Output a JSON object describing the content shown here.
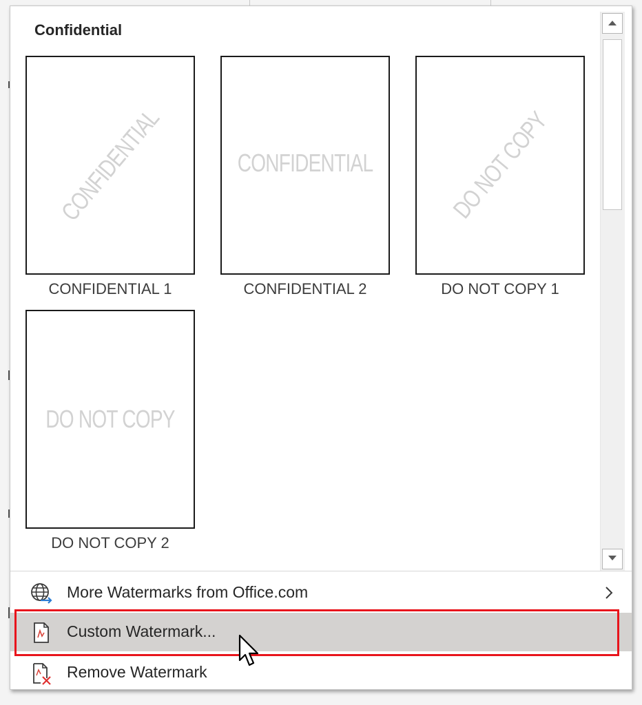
{
  "gallery": {
    "section_title": "Confidential",
    "items": [
      {
        "label": "CONFIDENTIAL 1",
        "watermark_text": "CONFIDENTIAL",
        "orientation": "diagonal"
      },
      {
        "label": "CONFIDENTIAL 2",
        "watermark_text": "CONFIDENTIAL",
        "orientation": "horizontal"
      },
      {
        "label": "DO NOT COPY 1",
        "watermark_text": "DO NOT COPY",
        "orientation": "diagonal"
      },
      {
        "label": "DO NOT COPY 2",
        "watermark_text": "DO NOT COPY",
        "orientation": "horizontal"
      }
    ]
  },
  "menu": {
    "more_watermarks": {
      "label": "More Watermarks from Office.com",
      "icon": "globe-icon",
      "has_submenu": true
    },
    "custom_watermark": {
      "label": "Custom Watermark...",
      "icon": "custom-watermark-icon",
      "highlighted": true
    },
    "remove_watermark": {
      "label": "Remove Watermark",
      "icon": "remove-watermark-icon"
    }
  },
  "colors": {
    "highlight_border": "#e8141c",
    "hover_background": "#d4d2d0",
    "watermark_text": "#d2d2d2"
  }
}
